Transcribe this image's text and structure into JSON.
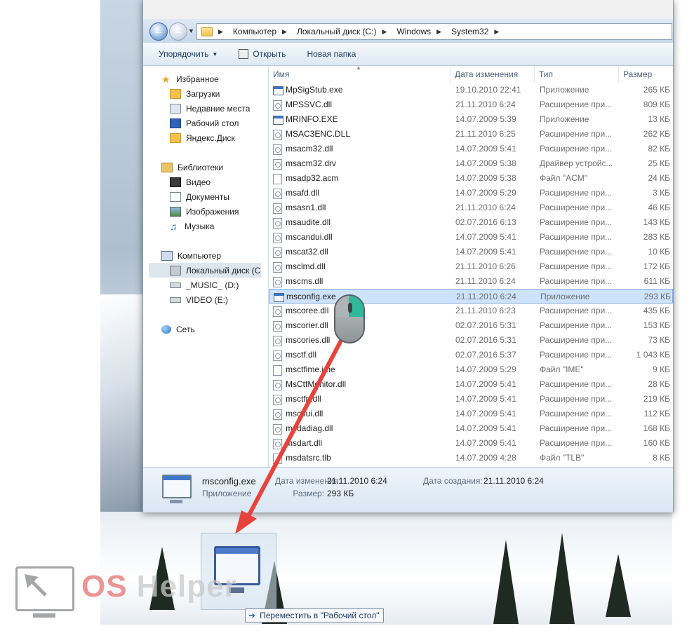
{
  "address_bar": {
    "breadcrumbs": [
      "Компьютер",
      "Локальный диск (C:)",
      "Windows",
      "System32"
    ]
  },
  "toolbar": {
    "organize": "Упорядочить",
    "open": "Открыть",
    "new_folder": "Новая папка"
  },
  "nav": {
    "favorites": "Избранное",
    "downloads": "Загрузки",
    "recent": "Недавние места",
    "desktop": "Рабочий стол",
    "yandex": "Яндекс.Диск",
    "libraries": "Библиотеки",
    "video": "Видео",
    "documents": "Документы",
    "pictures": "Изображения",
    "music": "Музыка",
    "computer": "Компьютер",
    "local_disk": "Локальный диск (C",
    "music_d": "_MUSIC_ (D:)",
    "video_e": "VIDEO (E:)",
    "network": "Сеть"
  },
  "columns": {
    "name": "Имя",
    "date": "Дата изменения",
    "type": "Тип",
    "size": "Размер"
  },
  "files": [
    {
      "name": "MpSigStub.exe",
      "date": "19.10.2010 22:41",
      "type": "Приложение",
      "size": "265 КБ",
      "icon": "exe"
    },
    {
      "name": "MPSSVC.dll",
      "date": "21.11.2010 6:24",
      "type": "Расширение при...",
      "size": "809 КБ",
      "icon": "dll"
    },
    {
      "name": "MRINFO.EXE",
      "date": "14.07.2009 5:39",
      "type": "Приложение",
      "size": "13 КБ",
      "icon": "exe"
    },
    {
      "name": "MSAC3ENC.DLL",
      "date": "21.11.2010 6:25",
      "type": "Расширение при...",
      "size": "262 КБ",
      "icon": "dll"
    },
    {
      "name": "msacm32.dll",
      "date": "14.07.2009 5:41",
      "type": "Расширение при...",
      "size": "82 КБ",
      "icon": "dll"
    },
    {
      "name": "msacm32.drv",
      "date": "14.07.2009 5:38",
      "type": "Драйвер устройс...",
      "size": "25 КБ",
      "icon": "dll"
    },
    {
      "name": "msadp32.acm",
      "date": "14.07.2009 5:38",
      "type": "Файл \"ACM\"",
      "size": "24 КБ",
      "icon": "file"
    },
    {
      "name": "msafd.dll",
      "date": "14.07.2009 5:29",
      "type": "Расширение при...",
      "size": "3 КБ",
      "icon": "dll"
    },
    {
      "name": "msasn1.dll",
      "date": "21.11.2010 6:24",
      "type": "Расширение при...",
      "size": "46 КБ",
      "icon": "dll"
    },
    {
      "name": "msaudite.dll",
      "date": "02.07.2016 6:13",
      "type": "Расширение при...",
      "size": "143 КБ",
      "icon": "dll"
    },
    {
      "name": "mscandui.dll",
      "date": "14.07.2009 5:41",
      "type": "Расширение при...",
      "size": "283 КБ",
      "icon": "dll"
    },
    {
      "name": "mscat32.dll",
      "date": "14.07.2009 5:41",
      "type": "Расширение при...",
      "size": "10 КБ",
      "icon": "dll"
    },
    {
      "name": "msclmd.dll",
      "date": "21.11.2010 6:26",
      "type": "Расширение при...",
      "size": "172 КБ",
      "icon": "dll"
    },
    {
      "name": "mscms.dll",
      "date": "21.11.2010 6:24",
      "type": "Расширение при...",
      "size": "611 КБ",
      "icon": "dll"
    },
    {
      "name": "msconfig.exe",
      "date": "21.11.2010 6:24",
      "type": "Приложение",
      "size": "293 КБ",
      "icon": "exe",
      "selected": true
    },
    {
      "name": "mscoree.dll",
      "date": "21.11.2010 6:23",
      "type": "Расширение при...",
      "size": "435 КБ",
      "icon": "dll"
    },
    {
      "name": "mscorier.dll",
      "date": "02.07.2016 5:31",
      "type": "Расширение при...",
      "size": "153 КБ",
      "icon": "dll"
    },
    {
      "name": "mscories.dll",
      "date": "02.07.2016 5:31",
      "type": "Расширение при...",
      "size": "73 КБ",
      "icon": "dll"
    },
    {
      "name": "msctf.dll",
      "date": "02.07.2016 5:37",
      "type": "Расширение при...",
      "size": "1 043 КБ",
      "icon": "dll"
    },
    {
      "name": "msctfime.ime",
      "date": "14.07.2009 5:29",
      "type": "Файл \"IME\"",
      "size": "9 КБ",
      "icon": "file"
    },
    {
      "name": "MsCtfMonitor.dll",
      "date": "14.07.2009 5:41",
      "type": "Расширение при...",
      "size": "28 КБ",
      "icon": "dll"
    },
    {
      "name": "msctfp.dll",
      "date": "14.07.2009 5:41",
      "type": "Расширение при...",
      "size": "219 КБ",
      "icon": "dll"
    },
    {
      "name": "msctfui.dll",
      "date": "14.07.2009 5:41",
      "type": "Расширение при...",
      "size": "112 КБ",
      "icon": "dll"
    },
    {
      "name": "msdadiag.dll",
      "date": "14.07.2009 5:41",
      "type": "Расширение при...",
      "size": "168 КБ",
      "icon": "dll"
    },
    {
      "name": "msdart.dll",
      "date": "14.07.2009 5:41",
      "type": "Расширение при...",
      "size": "160 КБ",
      "icon": "dll"
    },
    {
      "name": "msdatsrc.tlb",
      "date": "14.07.2009 4:28",
      "type": "Файл \"TLB\"",
      "size": "8 КБ",
      "icon": "file"
    }
  ],
  "details": {
    "name": "msconfig.exe",
    "type": "Приложение",
    "modified_label": "Дата изменения:",
    "modified_value": "21.11.2010 6:24",
    "created_label": "Дата создания:",
    "created_value": "21.11.2010 6:24",
    "size_label": "Размер:",
    "size_value": "293 КБ"
  },
  "drag_tooltip": "Переместить в \"Рабочий стол\"",
  "watermark": {
    "os": "OS",
    "rest": " Helper"
  },
  "colors": {
    "selection": "#cde3fb",
    "arrow": "#e8423c",
    "mouse_button": "#2fb89a"
  }
}
